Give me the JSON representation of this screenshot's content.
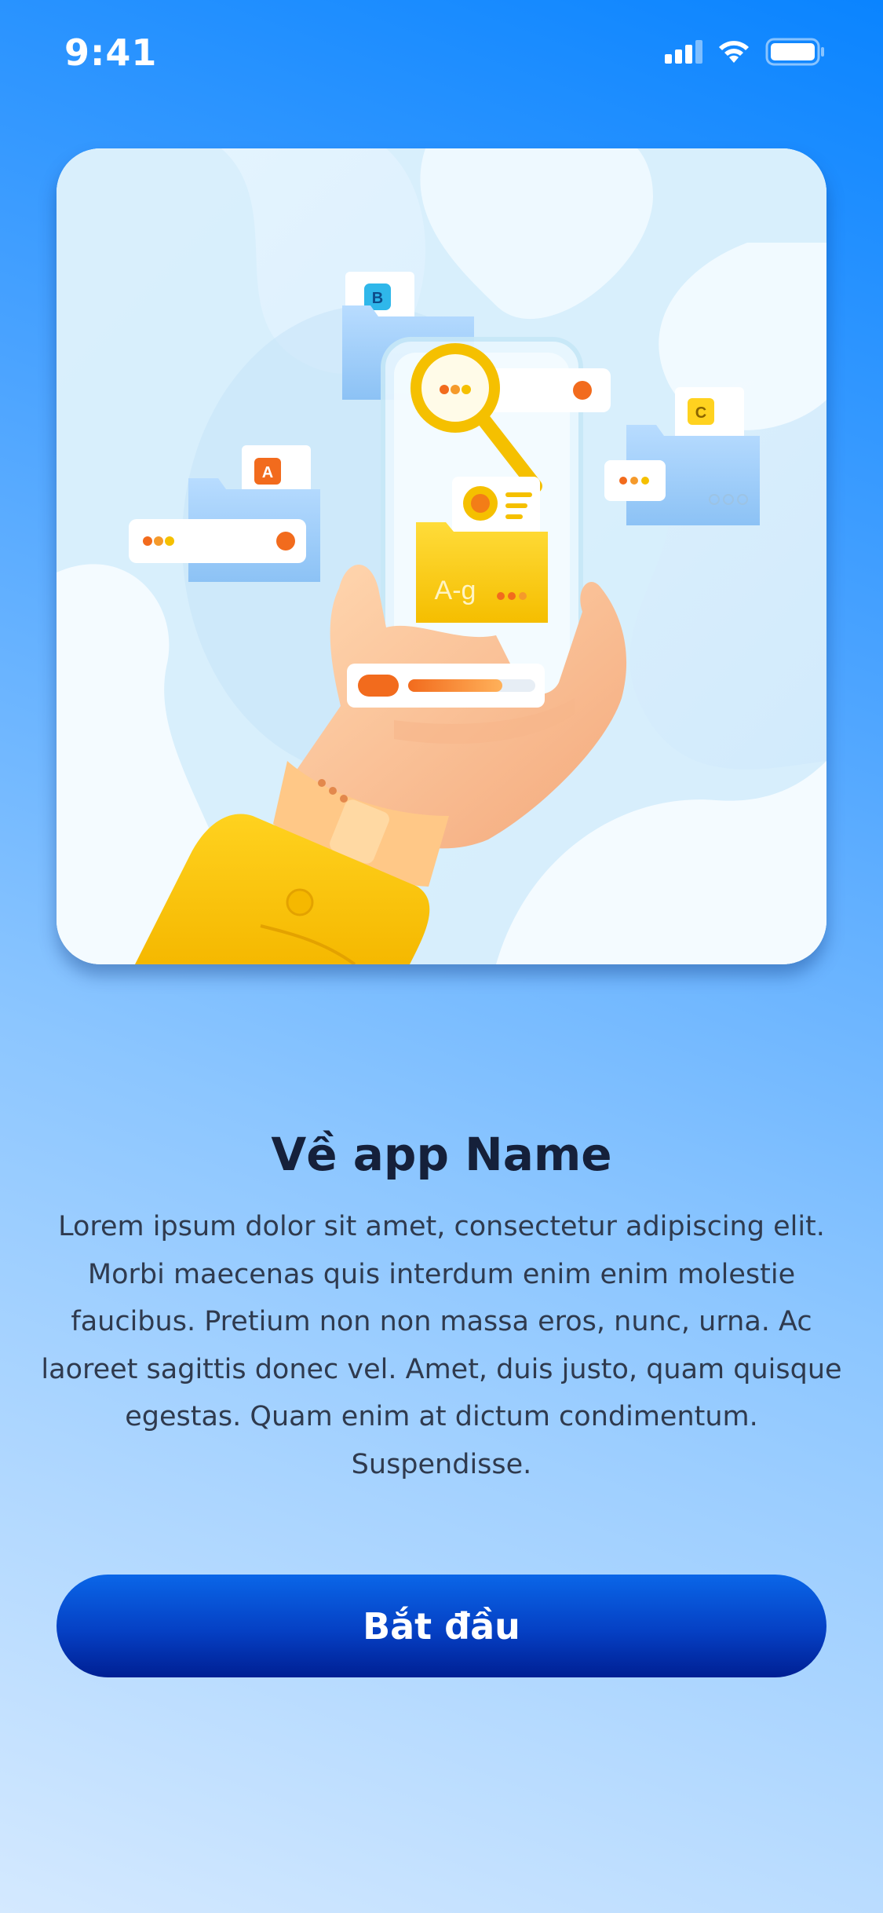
{
  "status_bar": {
    "time": "9:41",
    "icons": [
      "signal-icon",
      "wifi-icon",
      "battery-icon"
    ]
  },
  "hero": {
    "illustration": "hand-holding-phone-with-folders-illustration",
    "labels": {
      "folder_a": "A",
      "folder_b": "B",
      "folder_c": "C",
      "phone_folder": "A-g"
    }
  },
  "content": {
    "title": "Về app Name",
    "description_lines": [
      "Lorem ipsum dolor sit amet, consectetur adipiscing elit.",
      "Morbi maecenas quis interdum enim enim molestie",
      "faucibus. Pretium non non massa eros, nunc, urna. Ac",
      "laoreet sagittis donec vel. Amet, duis justo, quam quisque",
      "egestas. Quam enim at dictum condimentum. Suspendisse."
    ]
  },
  "actions": {
    "start_label": "Bắt đầu"
  },
  "colors": {
    "primary": "#0540c4",
    "accent_orange": "#f26b1d",
    "accent_yellow": "#ffd21f",
    "title_text": "#15203a"
  }
}
